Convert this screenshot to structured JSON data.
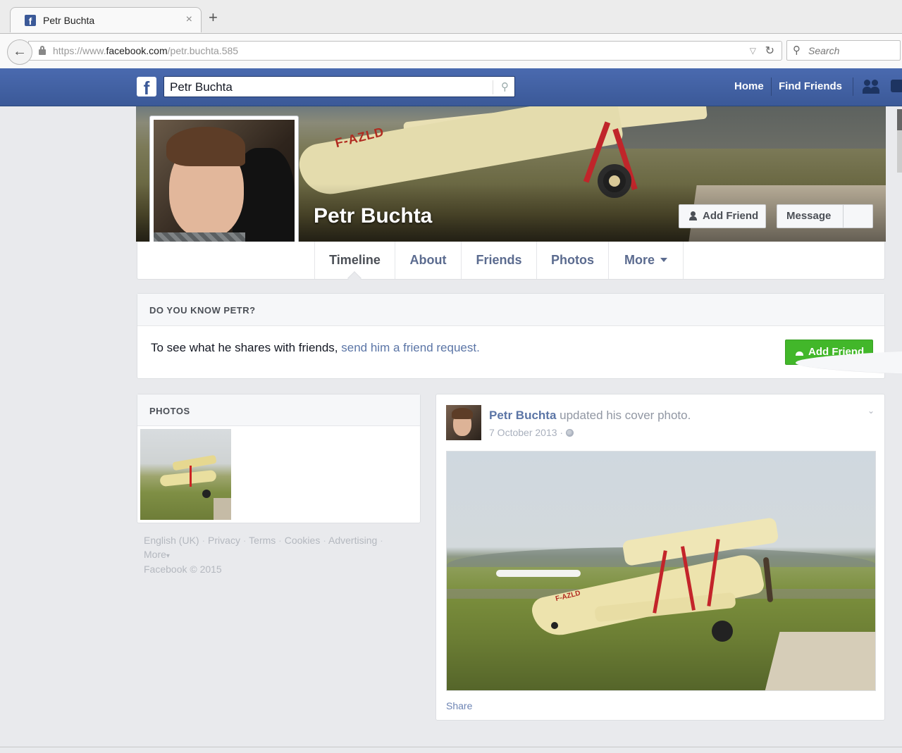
{
  "browser": {
    "tab_title": "Petr Buchta",
    "tab_close": "×",
    "new_tab": "+",
    "url_prefix": "https://www.",
    "url_domain": "facebook.com",
    "url_path": "/petr.buchta.585",
    "search_placeholder": "Search"
  },
  "fb_header": {
    "logo": "f",
    "search_value": "Petr Buchta",
    "nav": {
      "home": "Home",
      "find_friends": "Find Friends"
    },
    "colors": {
      "bar": "#3b5998"
    }
  },
  "profile": {
    "name": "Petr Buchta",
    "cover_registration": "F-AZLD",
    "add_friend_label": "Add Friend",
    "message_label": "Message"
  },
  "timeline_nav": {
    "tabs": [
      {
        "label": "Timeline",
        "active": true
      },
      {
        "label": "About"
      },
      {
        "label": "Friends"
      },
      {
        "label": "Photos"
      },
      {
        "label": "More"
      }
    ]
  },
  "know_box": {
    "heading": "DO YOU KNOW PETR?",
    "text": "To see what he shares with friends, ",
    "link": "send him a friend request.",
    "button": "Add Friend",
    "button_color": "#42b72a"
  },
  "photos_box": {
    "heading": "PHOTOS"
  },
  "footer": {
    "links": [
      "English (UK)",
      "Privacy",
      "Terms",
      "Cookies",
      "Advertising",
      "More"
    ],
    "separator": "·",
    "more_caret": "▾",
    "copyright": "Facebook © 2015"
  },
  "post": {
    "author": "Petr Buchta",
    "action": " updated his cover photo.",
    "date": "7 October 2013",
    "date_sep": "·",
    "menu": "⌄",
    "photo_registration": "F-AZLD",
    "share": "Share"
  }
}
